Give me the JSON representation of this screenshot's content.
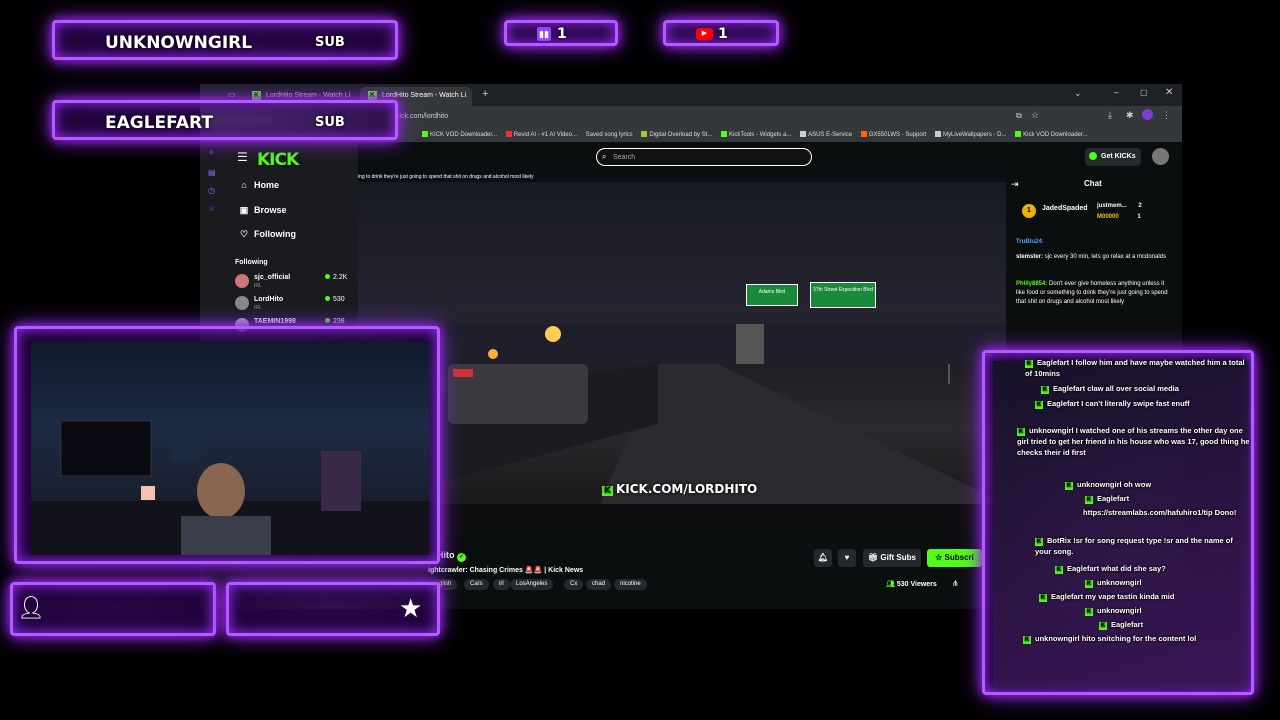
{
  "alerts": {
    "alert1": {
      "name": "UNKNOWNGIRL",
      "type": "SUB"
    },
    "alert2": {
      "name": "EAGLEFART",
      "type": "SUB"
    },
    "twitch_count": "1",
    "youtube_count": "1"
  },
  "browser": {
    "tabs": [
      {
        "label": "LordHito Stream - Watch Li"
      },
      {
        "label": "LordHito Stream - Watch Li"
      }
    ],
    "new_tab": "+",
    "url": "kick.com/lordhito",
    "bookmarks": [
      "KICK VOD Downloader...",
      "Revid AI - #1 AI Video...",
      "Saved song lyrics",
      "Digital Overload by St...",
      "KickTools - Widgets a...",
      "ASUS E-Service",
      "GX550LWS - Support",
      "MyLiveWallpapers - D...",
      "Kick VOD Downloader..."
    ]
  },
  "kick": {
    "logo": "KICK",
    "search_placeholder": "Search",
    "get_kicks": "Get KICKs",
    "nav": [
      {
        "label": "Home",
        "icon": "home-icon"
      },
      {
        "label": "Browse",
        "icon": "browse-icon"
      },
      {
        "label": "Following",
        "icon": "heart-icon"
      }
    ],
    "following_title": "Following",
    "following": [
      {
        "name": "sjc_official",
        "category": "IRL",
        "viewers": "2.2K"
      },
      {
        "name": "LordHito",
        "category": "IRL",
        "viewers": "530"
      },
      {
        "name": "TAEMIN1998",
        "category": "",
        "viewers": "238"
      }
    ],
    "ticker": "ing to drink they're just going to spend that shit on drugs and alcohol most likely",
    "video_overlay_url": "KICK.COM/LORDHITO",
    "road_signs": [
      "Adams Blvd",
      "37th Street Exposition Blvd"
    ],
    "streamer": "Hito",
    "stream_title": "ightcrawler: Chasing Crimes 🚨🚨 | Kick News",
    "tags": [
      "glish",
      "Cars",
      "irl",
      "LosAngeles",
      "Cx",
      "chad",
      "nicotine"
    ],
    "gift_subs": "Gift Subs",
    "subscribe": "Subscri",
    "viewers": "530 Viewers"
  },
  "browser_chat": {
    "title": "Chat",
    "top_gifter": "JadedSpaded",
    "leaderboard": [
      {
        "name": "justmem...",
        "count": "2"
      },
      {
        "name": "M00000",
        "count": "1"
      }
    ],
    "messages": [
      {
        "user": "TruBlu24:",
        "text": ""
      },
      {
        "user": "stemster:",
        "text": "sjc every 30 min, lets go relax at a mcdonalds"
      },
      {
        "user": "Philly8854:",
        "text": "Don't ever give homeless anything unless it like food or something to drink they're just going to spend that shit on drugs and alcohol most likely"
      }
    ]
  },
  "overlay_chat": [
    {
      "user": "Eaglefart",
      "text": "I follow him and have maybe watched him a total of 10mins"
    },
    {
      "user": "Eaglefart",
      "text": "claw all over social media"
    },
    {
      "user": "Eaglefart",
      "text": "I can't literally swipe fast enuff"
    },
    {
      "user": "unknowngirl",
      "text": "I watched one of his streams the other day one girl tried to get her friend in his house who was 17, good thing he checks their id first"
    },
    {
      "user": "unknowngirl",
      "text": "oh wow"
    },
    {
      "user": "Eaglefart",
      "text": ""
    },
    {
      "user": "",
      "text": "https://streamlabs.com/hafuhiro1/tip Dono!"
    },
    {
      "user": "BotRix",
      "text": "!sr for song request type !sr and the name of your song."
    },
    {
      "user": "Eaglefart",
      "text": "what did she say?"
    },
    {
      "user": "unknowngirl",
      "text": ""
    },
    {
      "user": "Eaglefart",
      "text": "my vape tastin kinda mid"
    },
    {
      "user": "unknowngirl",
      "text": ""
    },
    {
      "user": "Eaglefart",
      "text": ""
    },
    {
      "user": "unknowngirl",
      "text": "hito snitching for the content lol"
    }
  ],
  "colors": {
    "neon": "#b25cff",
    "kick_green": "#53fc18",
    "twitch": "#9146ff",
    "youtube": "#ff0000"
  }
}
